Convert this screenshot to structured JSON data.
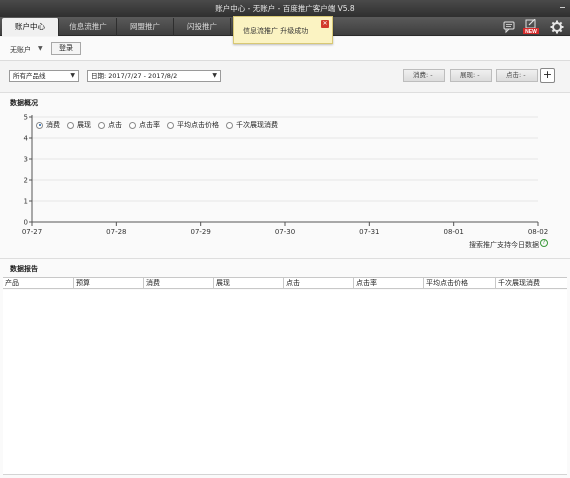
{
  "window": {
    "title": "账户中心 - 无账户 - 百度推广客户端 V5.8"
  },
  "tabs": [
    {
      "label": "账户中心"
    },
    {
      "label": "信息流推广"
    },
    {
      "label": "网盟推广"
    },
    {
      "label": "闪投推广"
    }
  ],
  "toast": {
    "message": "信息流推广  升级成功"
  },
  "account": {
    "name": "无账户",
    "login_label": "登录"
  },
  "filters": {
    "product_line": "所有产品线",
    "date_range": "日期: 2017/7/27 - 2017/8/2",
    "metrics": [
      "消费: -",
      "展现: -",
      "点击: -"
    ],
    "add_label": "+"
  },
  "overview": {
    "title": "数据概况",
    "legend": [
      "消费",
      "展现",
      "点击",
      "点击率",
      "平均点击价格",
      "千次展现消费"
    ],
    "selected_metric": "消费",
    "note": "搜索推广支持今日数据",
    "help_label": "?"
  },
  "chart_data": {
    "type": "line",
    "categories": [
      "07-27",
      "07-28",
      "07-29",
      "07-30",
      "07-31",
      "08-01",
      "08-02"
    ],
    "y_ticks": [
      "0",
      "1",
      "2",
      "3",
      "4",
      "5"
    ],
    "ylim": [
      0,
      5
    ],
    "grid": true,
    "series": [],
    "legend_placement": "top-left"
  },
  "report": {
    "title": "数据报告",
    "columns": [
      "产品",
      "预算",
      "消费",
      "展现",
      "点击",
      "点击率",
      "平均点击价格",
      "千次展现消费"
    ]
  },
  "colors": {
    "accent": "#1c5fa8",
    "titlebar": "#3a3a3a",
    "new_badge": "#d42a2a"
  }
}
